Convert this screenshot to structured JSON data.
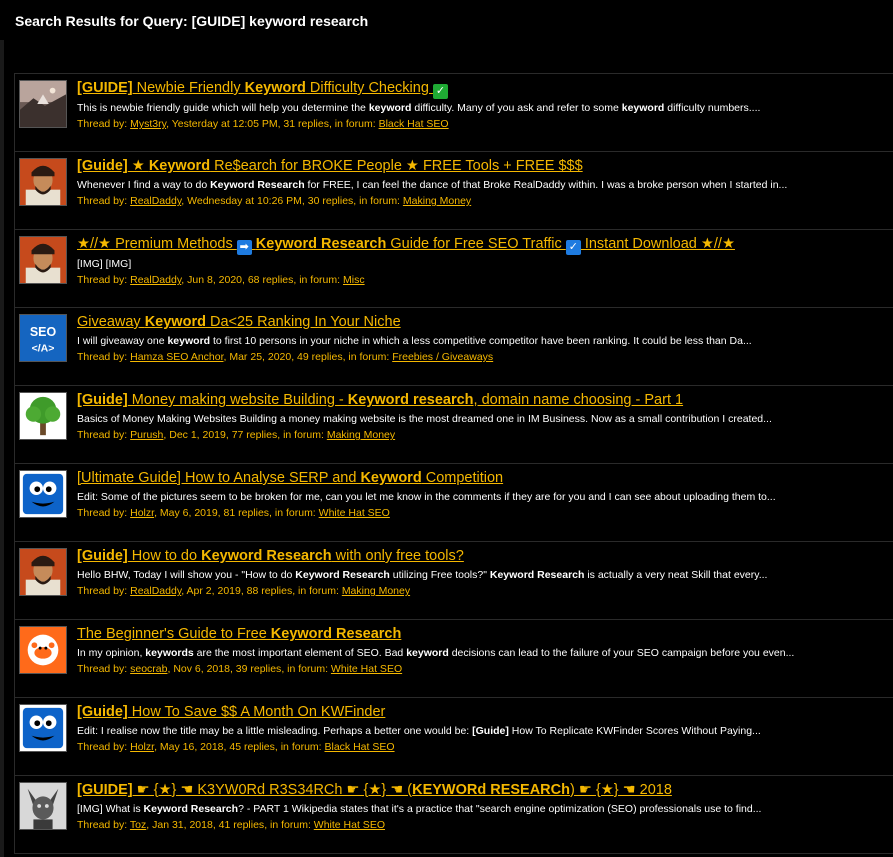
{
  "page": {
    "title": "Search Results for Query: [GUIDE] keyword research"
  },
  "meta_labels": {
    "thread_by": "Thread by:",
    "in_forum": ", in forum:"
  },
  "results": [
    {
      "title_parts": [
        {
          "t": "[GUIDE]",
          "b": true
        },
        {
          "t": " Newbie Friendly ",
          "b": false
        },
        {
          "t": "Keyword",
          "b": true
        },
        {
          "t": " Difficulty Checking ",
          "b": false
        }
      ],
      "badge": {
        "glyph": "✓",
        "color": "#1faa34"
      },
      "title_tail": [],
      "snippet_parts": [
        {
          "t": "This is newbie friendly guide which will help you determine the ",
          "b": false
        },
        {
          "t": "keyword",
          "b": true
        },
        {
          "t": " difficulty. Many of you ask and refer to some ",
          "b": false
        },
        {
          "t": "keyword",
          "b": true
        },
        {
          "t": " difficulty numbers....",
          "b": false
        }
      ],
      "author": "Myst3ry",
      "details": ", Yesterday at 12:05 PM, 31 replies",
      "forum": "Black Hat SEO",
      "avatar": "landscape"
    },
    {
      "title_parts": [
        {
          "t": "[Guide]",
          "b": true
        },
        {
          "t": " ★ ",
          "b": false
        },
        {
          "t": "Keyword",
          "b": true
        },
        {
          "t": " Re$earch for BROKE People ★ FREE Tools + FREE $$$",
          "b": false
        }
      ],
      "badge": null,
      "title_tail": [],
      "snippet_parts": [
        {
          "t": "Whenever I find a way to do ",
          "b": false
        },
        {
          "t": "Keyword Research",
          "b": true
        },
        {
          "t": " for FREE, I can feel the dance of that Broke RealDaddy within. I was a broke person when I started in...",
          "b": false
        }
      ],
      "author": "RealDaddy",
      "details": ", Wednesday at 10:26 PM, 30 replies",
      "forum": "Making Money",
      "avatar": "portrait"
    },
    {
      "title_parts": [
        {
          "t": "★//★ Premium Methods ",
          "b": false
        }
      ],
      "badge": {
        "glyph": "➡",
        "color": "#1e7be0"
      },
      "title_tail": [
        {
          "t": " ",
          "b": false
        },
        {
          "t": "Keyword Research",
          "b": true
        },
        {
          "t": " Guide for Free SEO Traffic ",
          "b": false
        }
      ],
      "badge2": {
        "glyph": "✓",
        "color": "#1e7be0"
      },
      "title_tail2": [
        {
          "t": " Instant Download ★//★",
          "b": false
        }
      ],
      "snippet_parts": [
        {
          "t": "[IMG] [IMG]",
          "b": false
        }
      ],
      "author": "RealDaddy",
      "details": ", Jun 8, 2020, 68 replies",
      "forum": "Misc",
      "avatar": "portrait"
    },
    {
      "title_parts": [
        {
          "t": "Giveaway ",
          "b": false
        },
        {
          "t": "Keyword",
          "b": true
        },
        {
          "t": " Da<25 Ranking In Your Niche",
          "b": false
        }
      ],
      "badge": null,
      "title_tail": [],
      "snippet_parts": [
        {
          "t": "I will giveaway one ",
          "b": false
        },
        {
          "t": "keyword",
          "b": true
        },
        {
          "t": " to first 10 persons in your niche in which a less competitive competitor have been ranking. It could be less than Da...",
          "b": false
        }
      ],
      "author": "Hamza SEO Anchor",
      "details": ", Mar 25, 2020, 49 replies",
      "forum": "Freebies / Giveaways",
      "avatar": "seo",
      "avatar_text": {
        "line1": "SEO",
        "line2": "</A>"
      }
    },
    {
      "title_parts": [
        {
          "t": "[Guide]",
          "b": true
        },
        {
          "t": " Money making website Building - ",
          "b": false
        },
        {
          "t": "Keyword research",
          "b": true
        },
        {
          "t": ", domain name choosing - Part 1",
          "b": false
        }
      ],
      "badge": null,
      "title_tail": [],
      "snippet_parts": [
        {
          "t": "Basics of Money Making Websites Building a money making website is the most dreamed one in IM Business. Now as a small contribution I created...",
          "b": false
        }
      ],
      "author": "Purush",
      "details": ", Dec 1, 2019, 77 replies",
      "forum": "Making Money",
      "avatar": "tree"
    },
    {
      "title_parts": [
        {
          "t": "[Ultimate Guide] How to Analyse SERP and ",
          "b": false
        },
        {
          "t": "Keyword",
          "b": true
        },
        {
          "t": " Competition",
          "b": false
        }
      ],
      "badge": null,
      "title_tail": [],
      "snippet_parts": [
        {
          "t": "Edit: Some of the pictures seem to be broken for me, can you let me know in the comments if they are for you and I can see about uploading them to...",
          "b": false
        }
      ],
      "author": "Holzr",
      "details": ", May 6, 2019, 81 replies",
      "forum": "White Hat SEO",
      "avatar": "monster"
    },
    {
      "title_parts": [
        {
          "t": "[Guide]",
          "b": true
        },
        {
          "t": " How to do ",
          "b": false
        },
        {
          "t": "Keyword Research",
          "b": true
        },
        {
          "t": " with only free tools?",
          "b": false
        }
      ],
      "badge": null,
      "title_tail": [],
      "snippet_parts": [
        {
          "t": "Hello BHW, Today I will show you - \"How to do ",
          "b": false
        },
        {
          "t": "Keyword Research",
          "b": true
        },
        {
          "t": " utilizing Free tools?\" ",
          "b": false
        },
        {
          "t": "Keyword Research",
          "b": true
        },
        {
          "t": " is actually a very neat Skill that every...",
          "b": false
        }
      ],
      "author": "RealDaddy",
      "details": ", Apr 2, 2019, 88 replies",
      "forum": "Making Money",
      "avatar": "portrait"
    },
    {
      "title_parts": [
        {
          "t": "The Beginner's Guide to Free ",
          "b": false
        },
        {
          "t": "Keyword Research",
          "b": true
        }
      ],
      "badge": null,
      "title_tail": [],
      "snippet_parts": [
        {
          "t": "In my opinion, ",
          "b": false
        },
        {
          "t": "keywords",
          "b": true
        },
        {
          "t": " are the most important element of SEO. Bad ",
          "b": false
        },
        {
          "t": "keyword",
          "b": true
        },
        {
          "t": " decisions can lead to the failure of your SEO campaign before you even...",
          "b": false
        }
      ],
      "author": "seocrab",
      "details": ", Nov 6, 2018, 39 replies",
      "forum": "White Hat SEO",
      "avatar": "crab"
    },
    {
      "title_parts": [
        {
          "t": "[Guide]",
          "b": true
        },
        {
          "t": " How To Save $$ A Month On KWFinder",
          "b": false
        }
      ],
      "badge": null,
      "title_tail": [],
      "snippet_parts": [
        {
          "t": "Edit: I realise now the title may be a little misleading. Perhaps a better one would be: ",
          "b": false
        },
        {
          "t": "[Guide]",
          "b": true
        },
        {
          "t": " How To Replicate KWFinder Scores Without Paying...",
          "b": false
        }
      ],
      "author": "Holzr",
      "details": ", May 16, 2018, 45 replies",
      "forum": "Black Hat SEO",
      "avatar": "monster"
    },
    {
      "title_parts": [
        {
          "t": "[GUIDE]",
          "b": true
        },
        {
          "t": " ☛ {★} ☚ K3YW0Rd R3S34RCh ☛ {★} ☚ (",
          "b": false
        },
        {
          "t": "KEYWORd RESEARCh",
          "b": true
        },
        {
          "t": ") ☛ {★} ☚ 2018",
          "b": false
        }
      ],
      "badge": null,
      "title_tail": [],
      "snippet_parts": [
        {
          "t": "[IMG] What is ",
          "b": false
        },
        {
          "t": "Keyword Research",
          "b": true
        },
        {
          "t": "? - PART 1 Wikipedia states that it's a practice that \"search engine optimization (SEO) professionals use to find...",
          "b": false
        }
      ],
      "author": "Toz",
      "details": ", Jan 31, 2018, 41 replies",
      "forum": "White Hat SEO",
      "avatar": "gargoyle"
    }
  ]
}
